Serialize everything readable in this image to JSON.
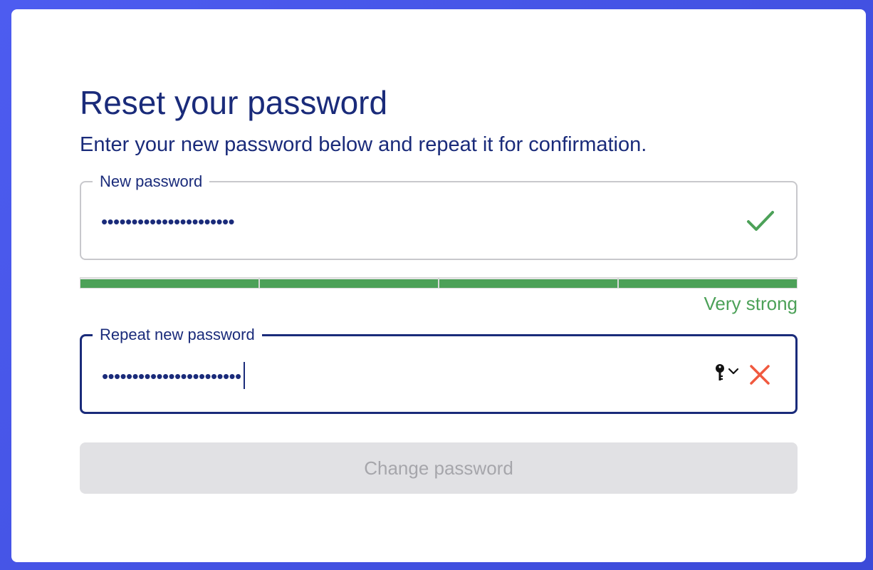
{
  "form": {
    "title": "Reset your password",
    "subtitle": "Enter your new password below and repeat it for confirmation.",
    "new_password": {
      "label": "New password",
      "masked_value": "••••••••••••••••••••••",
      "status_icon": "check-icon",
      "status_color": "#4ca158"
    },
    "strength": {
      "segments_filled": 4,
      "segments_total": 4,
      "label": "Very strong",
      "color": "#4ca158"
    },
    "repeat_password": {
      "label": "Repeat new password",
      "masked_value": "•••••••••••••••••••••••",
      "autofill_icon": "keychain-icon",
      "status_icon": "x-icon",
      "status_color": "#f0593f",
      "focused": true
    },
    "submit": {
      "label": "Change password",
      "disabled": true
    }
  },
  "colors": {
    "background": "#4d5cf0",
    "text_primary": "#1a2b7a",
    "success": "#4ca158",
    "error": "#f0593f",
    "button_disabled_bg": "#e1e1e4",
    "button_disabled_text": "#a6a6ab"
  }
}
